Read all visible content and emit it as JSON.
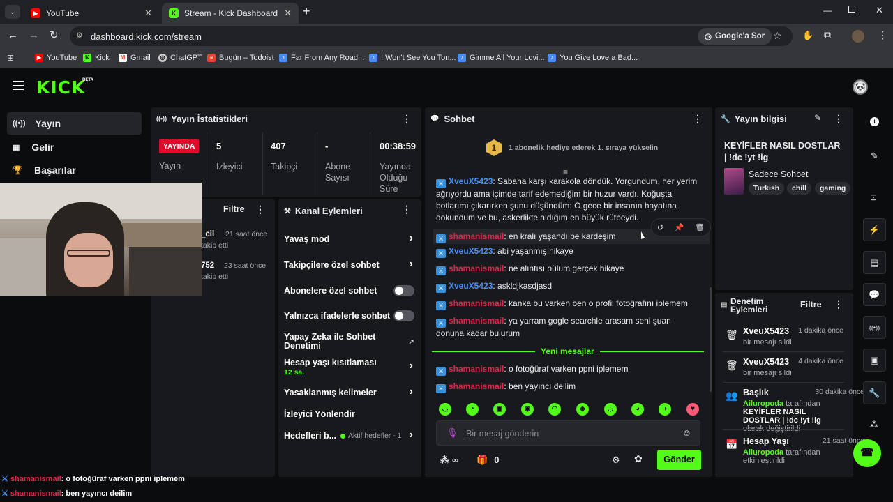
{
  "browser": {
    "tabs": [
      {
        "title": "YouTube",
        "icon": "youtube-icon",
        "color": "#ff0000",
        "active": false
      },
      {
        "title": "Stream - Kick Dashboard",
        "icon": "kick-icon",
        "color": "#53fc18",
        "active": true
      }
    ],
    "new_tab": "+",
    "url": "dashboard.kick.com/stream",
    "google_btn": "Google'a Sor",
    "bookmarks": [
      {
        "label": "YouTube",
        "icon": "youtube-icon",
        "color": "#ff0000"
      },
      {
        "label": "Kick",
        "icon": "kick-icon",
        "color": "#53fc18"
      },
      {
        "label": "Gmail",
        "icon": "gmail-icon",
        "color": "#ea4335"
      },
      {
        "label": "ChatGPT",
        "icon": "chatgpt-icon",
        "color": "#cfcfcf"
      },
      {
        "label": "Bugün – Todoist",
        "icon": "todoist-icon",
        "color": "#e44332"
      },
      {
        "label": "Far From Any Road...",
        "icon": "bookmark-icon",
        "color": "#4c8bf5"
      },
      {
        "label": "I Won't See You Ton...",
        "icon": "bookmark-icon",
        "color": "#4c8bf5"
      },
      {
        "label": "Gimme All Your Lovi...",
        "icon": "bookmark-icon",
        "color": "#4c8bf5"
      },
      {
        "label": "You Give Love a Bad...",
        "icon": "bookmark-icon",
        "color": "#4c8bf5"
      }
    ]
  },
  "kick": {
    "logo": "KICK",
    "beta": "BETA",
    "accent": "#53fc18"
  },
  "sidebar": {
    "items": [
      {
        "label": "Yayın",
        "icon": "broadcast-icon"
      },
      {
        "label": "Gelir",
        "icon": "chart-icon"
      },
      {
        "label": "Başarılar",
        "icon": "trophy-icon"
      }
    ]
  },
  "stats": {
    "title": "Yayın İstatistikleri",
    "live": "YAYINDA",
    "live_label": "Yayın",
    "viewers": "5",
    "viewers_label": "İzleyici",
    "followers": "407",
    "followers_label": "Takipçi",
    "subs": "-",
    "subs_label": "Abone Sayısı",
    "duration": "00:38:59",
    "duration_label": "Yayında Olduğu Süre"
  },
  "recent": {
    "filter": "Filtre",
    "items": [
      {
        "name": "_cil",
        "time": "21 saat önce",
        "action": "takip etti"
      },
      {
        "name": "752",
        "time": "23 saat önce",
        "action": "takip etti"
      }
    ]
  },
  "channel_actions": {
    "title": "Kanal Eylemleri",
    "slow": "Yavaş mod",
    "followers_only": "Takipçilere özel sohbet",
    "subs_only": "Abonelere özel sohbet",
    "emote_only": "Yalnızca ifadelerle sohbet",
    "ai_mod": "Yapay Zeka ile Sohbet Denetimi",
    "account_age": "Hesap yaşı kısıtlaması",
    "account_age_value": "12 sa.",
    "banned_words": "Yasaklanmış kelimeler",
    "raid": "İzleyici Yönlendir",
    "goals": "Hedefleri b...",
    "goals_status": "Aktif hedefler - 1"
  },
  "chat": {
    "title": "Sohbet",
    "gift_banner": "1 abonelik hediye ederek 1. sıraya yükselin",
    "gift_rank": "1",
    "messages": [
      {
        "user": "XveuX5423",
        "text": ": Sabaha karşı karakola döndük. Yorgundum, her yerim ağrıyordu ama içimde tarif edemediğim bir huzur vardı. Koğuşta botlarımı çıkarırken şunu düşündüm: O gece bir insanın hayatına dokundum ve bu, askerlikte aldığım en büyük rütbeydi."
      },
      {
        "user": "shamanismail",
        "text": ": en kralı yaşandı be kardeşim"
      },
      {
        "user": "XveuX5423",
        "text": ": abi yaşanmış hikaye"
      },
      {
        "user": "shamanismail",
        "text": ": ne alıntısı oülum gerçek hikaye"
      },
      {
        "user": "XveuX5423",
        "text": ": askldjkasdjasd"
      },
      {
        "user": "shamanismail",
        "text": ": kanka bu varken ben o profil fotoğrafını iplemem"
      },
      {
        "user": "shamanismail",
        "text": ": ya yarram gogle searchle arasam seni şuan donuna kadar bulurum"
      },
      {
        "user": "shamanismail",
        "text": ": o fotoğüraf varken ppni iplemem"
      },
      {
        "user": "shamanismail",
        "text": ": ben yayıncı deilim"
      }
    ],
    "new_messages": "Yeni mesajlar",
    "placeholder": "Bir mesaj gönderin",
    "points": "0",
    "send": "Gönder",
    "infinity": "∞"
  },
  "stream_info": {
    "title": "Yayın bilgisi",
    "stream_title": "KEYİFLER NASIL DOSTLAR | !dc !yt !ig",
    "category": "Sadece Sohbet",
    "tags": [
      "Turkish",
      "chill",
      "gaming"
    ]
  },
  "moderation": {
    "title": "Denetim Eylemleri",
    "filter": "Filtre",
    "items": [
      {
        "name": "XveuX5423",
        "time": "1 dakika önce",
        "desc": "bir mesajı sildi",
        "icon": "trash-icon"
      },
      {
        "name": "XveuX5423",
        "time": "4 dakika önce",
        "desc": "bir mesajı sildi",
        "icon": "trash-icon"
      },
      {
        "name": "Başlık",
        "time": "30 dakika önce",
        "by": "Ailuropoda",
        "desc1": "tarafından",
        "value": "KEYİFLER NASIL DOSTLAR | !dc !yt !ig",
        "desc2": "olarak değiştirildi",
        "icon": "users-icon"
      },
      {
        "name": "Hesap Yaşı",
        "time": "21 saat önce",
        "by": "Ailuropoda",
        "desc1": "tarafından etkinleştirildi",
        "icon": "calendar-icon"
      }
    ]
  },
  "overlay": {
    "lines": [
      {
        "user": "shamanismail",
        "text": ": o fotoğüraf varken ppni iplemem"
      },
      {
        "user": "shamanismail",
        "text": ": ben yayıncı deilim"
      }
    ]
  }
}
